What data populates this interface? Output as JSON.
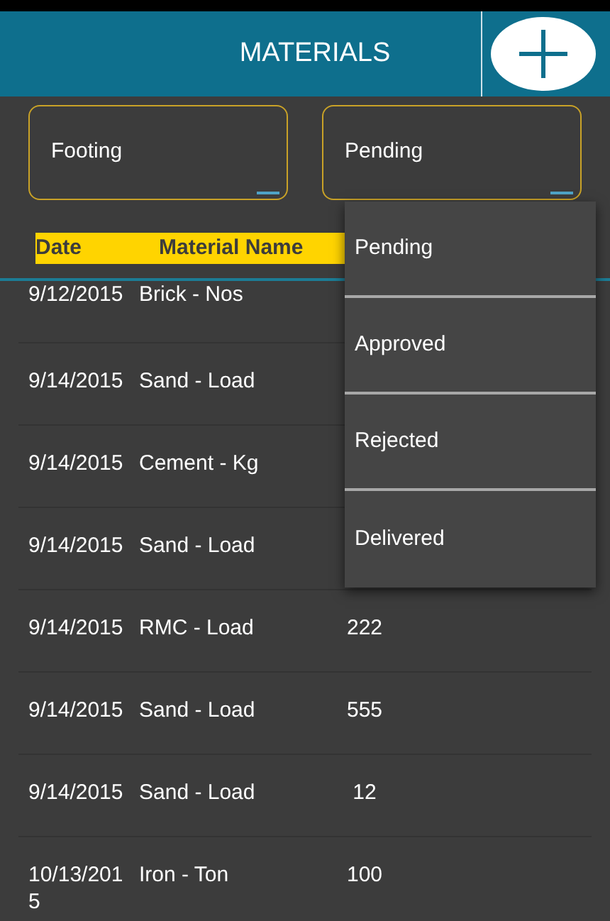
{
  "header": {
    "title": "MATERIALS"
  },
  "filters": [
    {
      "value": "Footing"
    },
    {
      "value": "Pending"
    }
  ],
  "table": {
    "columns": [
      "Date",
      "Material Name"
    ],
    "rows": [
      {
        "date": "9/12/2015",
        "material": "Brick - Nos"
      },
      {
        "date": "9/14/2015",
        "material": "Sand - Load"
      },
      {
        "date": "9/14/2015",
        "material": "Cement - Kg"
      },
      {
        "date": "9/14/2015",
        "material": "Sand - Load"
      },
      {
        "date": "9/14/2015",
        "material": "RMC - Load",
        "quantity": "222"
      },
      {
        "date": "9/14/2015",
        "material": "Sand - Load",
        "quantity": "555"
      },
      {
        "date": "9/14/2015",
        "material": "Sand - Load",
        "quantity": "12"
      },
      {
        "date": "10/13/2015",
        "material": "Iron - Ton",
        "quantity": "100"
      }
    ]
  },
  "dropdown_menu": {
    "items": [
      "Pending",
      "Approved",
      "Rejected",
      "Delivered"
    ]
  }
}
